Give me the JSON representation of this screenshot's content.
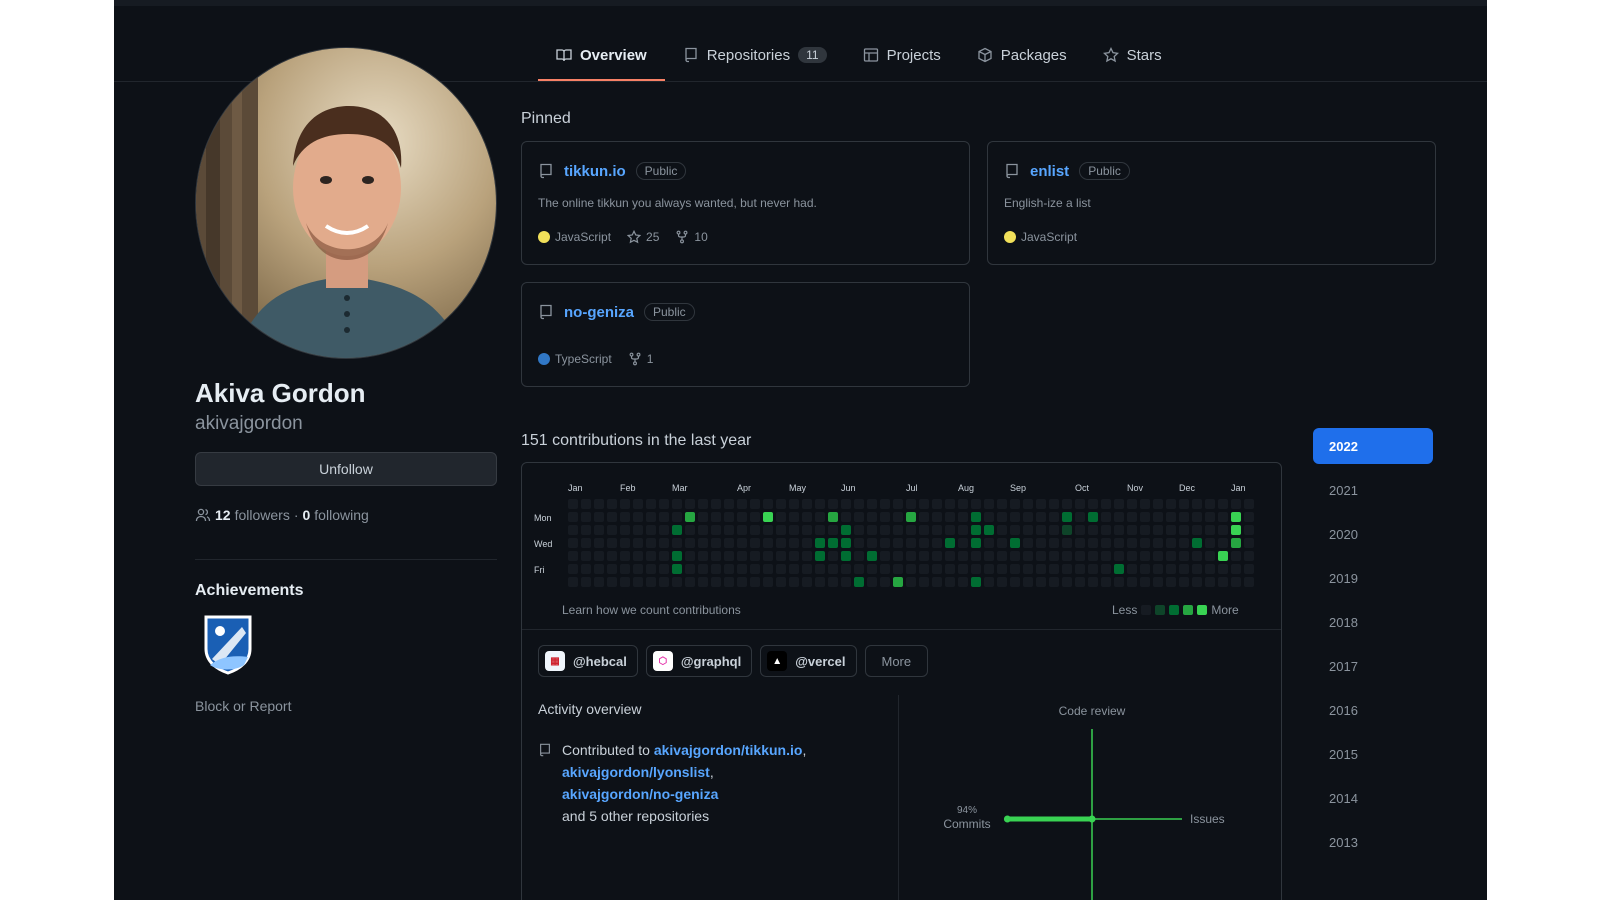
{
  "tabs": [
    {
      "label": "Overview",
      "icon": "book-icon",
      "active": true
    },
    {
      "label": "Repositories",
      "icon": "repo-icon",
      "count": "11"
    },
    {
      "label": "Projects",
      "icon": "table-icon"
    },
    {
      "label": "Packages",
      "icon": "package-icon"
    },
    {
      "label": "Stars",
      "icon": "star-icon"
    }
  ],
  "profile": {
    "name": "Akiva Gordon",
    "username": "akivajgordon",
    "unfollow_label": "Unfollow",
    "followers_count": "12",
    "followers_label": "followers",
    "separator": "·",
    "following_count": "0",
    "following_label": "following",
    "achievements_title": "Achievements",
    "block_label": "Block or Report"
  },
  "pinned": {
    "title": "Pinned",
    "repos": [
      {
        "name": "tikkun.io",
        "visibility": "Public",
        "description": "The online tikkun you always wanted, but never had.",
        "language": "JavaScript",
        "lang_color": "#f1e05a",
        "stars": "25",
        "forks": "10"
      },
      {
        "name": "enlist",
        "visibility": "Public",
        "description": "English-ize a list",
        "language": "JavaScript",
        "lang_color": "#f1e05a"
      },
      {
        "name": "no-geniza",
        "visibility": "Public",
        "description": "",
        "language": "TypeScript",
        "lang_color": "#3178c6",
        "forks": "1"
      }
    ]
  },
  "contributions": {
    "title": "151 contributions in the last year",
    "months": [
      "Jan",
      "Feb",
      "Mar",
      "Apr",
      "May",
      "Jun",
      "Jul",
      "Aug",
      "Sep",
      "Oct",
      "Nov",
      "Dec",
      "Jan"
    ],
    "days": [
      "Mon",
      "Wed",
      "Fri"
    ],
    "learn_label": "Learn how we count contributions",
    "less_label": "Less",
    "more_label": "More",
    "level_colors": [
      "#161b22",
      "#0e4429",
      "#006d32",
      "#26a641",
      "#39d353"
    ],
    "active_cells": [
      {
        "w": 9,
        "d": 1,
        "l": 3
      },
      {
        "w": 8,
        "d": 2,
        "l": 2
      },
      {
        "w": 8,
        "d": 4,
        "l": 2
      },
      {
        "w": 8,
        "d": 5,
        "l": 2
      },
      {
        "w": 15,
        "d": 1,
        "l": 4
      },
      {
        "w": 20,
        "d": 1,
        "l": 3
      },
      {
        "w": 19,
        "d": 3,
        "l": 2
      },
      {
        "w": 19,
        "d": 4,
        "l": 2
      },
      {
        "w": 20,
        "d": 3,
        "l": 2
      },
      {
        "w": 21,
        "d": 2,
        "l": 2
      },
      {
        "w": 21,
        "d": 3,
        "l": 2
      },
      {
        "w": 21,
        "d": 4,
        "l": 2
      },
      {
        "w": 23,
        "d": 4,
        "l": 2
      },
      {
        "w": 22,
        "d": 6,
        "l": 2
      },
      {
        "w": 25,
        "d": 6,
        "l": 3
      },
      {
        "w": 26,
        "d": 1,
        "l": 3
      },
      {
        "w": 29,
        "d": 3,
        "l": 2
      },
      {
        "w": 31,
        "d": 1,
        "l": 2
      },
      {
        "w": 31,
        "d": 2,
        "l": 2
      },
      {
        "w": 31,
        "d": 3,
        "l": 2
      },
      {
        "w": 31,
        "d": 6,
        "l": 2
      },
      {
        "w": 32,
        "d": 2,
        "l": 2
      },
      {
        "w": 34,
        "d": 3,
        "l": 2
      },
      {
        "w": 38,
        "d": 1,
        "l": 2
      },
      {
        "w": 38,
        "d": 2,
        "l": 1
      },
      {
        "w": 40,
        "d": 1,
        "l": 2
      },
      {
        "w": 42,
        "d": 5,
        "l": 2
      },
      {
        "w": 48,
        "d": 3,
        "l": 2
      },
      {
        "w": 51,
        "d": 1,
        "l": 4
      },
      {
        "w": 51,
        "d": 2,
        "l": 4
      },
      {
        "w": 51,
        "d": 3,
        "l": 3
      },
      {
        "w": 50,
        "d": 4,
        "l": 4
      }
    ]
  },
  "orgs": [
    {
      "handle": "@hebcal",
      "icon": "hebcal-logo-icon",
      "color": "#f0f6fc"
    },
    {
      "handle": "@graphql",
      "icon": "graphql-logo-icon",
      "color": "#e535ab"
    },
    {
      "handle": "@vercel",
      "icon": "vercel-logo-icon",
      "color": "#ffffff"
    }
  ],
  "orgs_more_label": "More",
  "activity": {
    "title": "Activity overview",
    "contributed_to": "Contributed to",
    "repo_links": [
      "akivajgordon/tikkun.io",
      "akivajgordon/lyonslist",
      "akivajgordon/no-geniza"
    ],
    "comma": ",",
    "other": "and 5 other repositories",
    "axes": {
      "top": "Code review",
      "right": "Issues",
      "left_pct": "94%",
      "left": "Commits"
    },
    "commits_fraction": 0.94
  },
  "years": [
    "2022",
    "2021",
    "2020",
    "2019",
    "2018",
    "2017",
    "2016",
    "2015",
    "2014",
    "2013"
  ],
  "selected_year": "2022",
  "colors": {
    "accent": "#58a6ff",
    "selected": "#1f6feb",
    "tab_underline": "#f78166",
    "green": "#2ea043"
  }
}
